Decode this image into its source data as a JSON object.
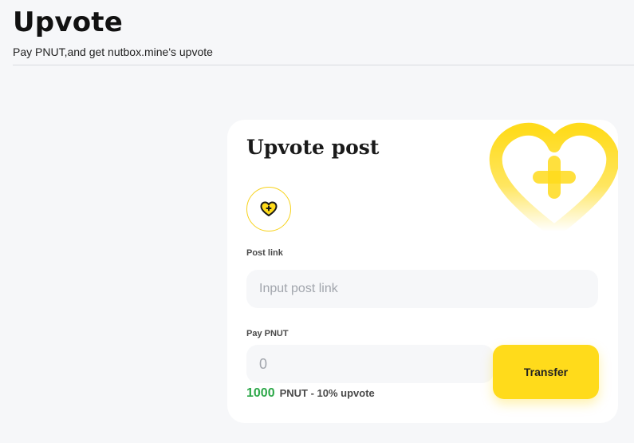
{
  "header": {
    "title": "Upvote",
    "subtitle": "Pay PNUT,and get nutbox.mine's upvote"
  },
  "card": {
    "title": "Upvote post",
    "post_link": {
      "label": "Post link",
      "placeholder": "Input post link"
    },
    "pay": {
      "label": "Pay PNUT",
      "placeholder": "0"
    },
    "transfer_label": "Transfer",
    "price": {
      "amount": "1000",
      "description": "PNUT - 10% upvote"
    }
  },
  "icons": {
    "card_icon": "heart-plus-icon",
    "decoration": "heart-plus-icon"
  },
  "colors": {
    "accent": "#ffdb1b",
    "price_green": "#2ea84a",
    "background": "#f6f7f9"
  }
}
